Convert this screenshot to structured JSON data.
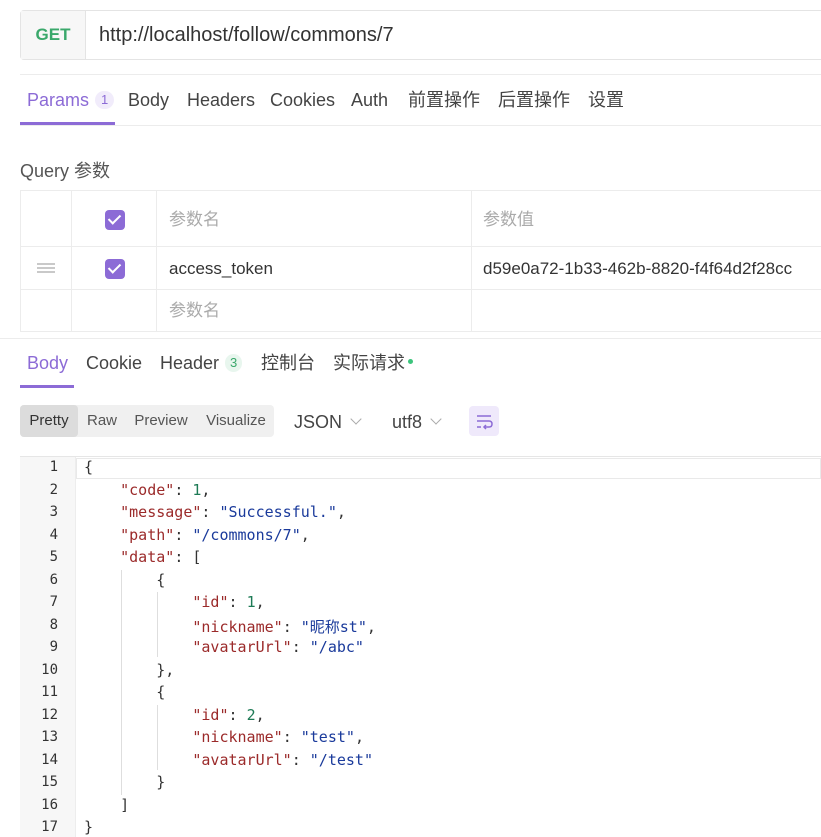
{
  "request": {
    "method": "GET",
    "url": "http://localhost/follow/commons/7"
  },
  "request_tabs": [
    {
      "label": "Params",
      "badge": "1"
    },
    {
      "label": "Body"
    },
    {
      "label": "Headers"
    },
    {
      "label": "Cookies"
    },
    {
      "label": "Auth"
    },
    {
      "label": "前置操作"
    },
    {
      "label": "后置操作"
    },
    {
      "label": "设置"
    }
  ],
  "query": {
    "title": "Query 参数",
    "header_name": "参数名",
    "header_value": "参数值",
    "rows": [
      {
        "name": "access_token",
        "value": "d59e0a72-1b33-462b-8820-f4f64d2f28cc",
        "checked": true
      }
    ],
    "placeholder_name": "参数名"
  },
  "response_tabs": [
    {
      "label": "Body"
    },
    {
      "label": "Cookie"
    },
    {
      "label": "Header",
      "badge": "3"
    },
    {
      "label": "控制台"
    },
    {
      "label": "实际请求"
    }
  ],
  "view_modes": [
    "Pretty",
    "Raw",
    "Preview",
    "Visualize"
  ],
  "format": "JSON",
  "encoding": "utf8",
  "code_lines": [
    "{",
    "    \"code\": 1,",
    "    \"message\": \"Successful.\",",
    "    \"path\": \"/commons/7\",",
    "    \"data\": [",
    "        {",
    "            \"id\": 1,",
    "            \"nickname\": \"昵称st\",",
    "            \"avatarUrl\": \"/abc\"",
    "        },",
    "        {",
    "            \"id\": 2,",
    "            \"nickname\": \"test\",",
    "            \"avatarUrl\": \"/test\"",
    "        }",
    "    ]",
    "}"
  ],
  "colors": {
    "accent": "#8c6bd6",
    "method": "#3aa86b",
    "key": "#9b2a2a",
    "string": "#1a3a9b",
    "number": "#1d7a55"
  }
}
